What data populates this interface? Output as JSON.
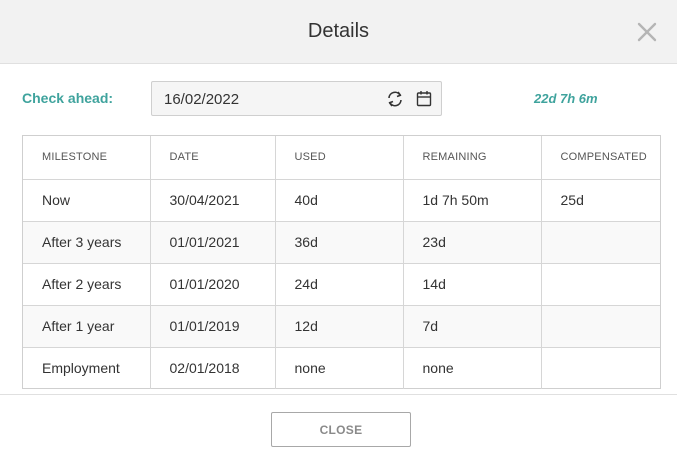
{
  "dialog": {
    "title": "Details",
    "close_button_label": "CLOSE"
  },
  "check_ahead": {
    "label": "Check ahead:",
    "date_value": "16/02/2022",
    "result": "22d 7h 6m"
  },
  "table": {
    "headers": [
      "MILESTONE",
      "DATE",
      "USED",
      "REMAINING",
      "COMPENSATED"
    ],
    "rows": [
      [
        "Now",
        "30/04/2021",
        "40d",
        "1d 7h 50m",
        "25d"
      ],
      [
        "After 3 years",
        "01/01/2021",
        "36d",
        "23d",
        ""
      ],
      [
        "After 2 years",
        "01/01/2020",
        "24d",
        "14d",
        ""
      ],
      [
        "After 1 year",
        "01/01/2019",
        "12d",
        "7d",
        ""
      ],
      [
        "Employment",
        "02/01/2018",
        "none",
        "none",
        ""
      ]
    ]
  },
  "colors": {
    "accent": "#3fa39d",
    "header_bg": "#f2f2f2"
  },
  "icons": {
    "close": "close-icon",
    "reset": "reset-icon",
    "calendar": "calendar-icon"
  }
}
